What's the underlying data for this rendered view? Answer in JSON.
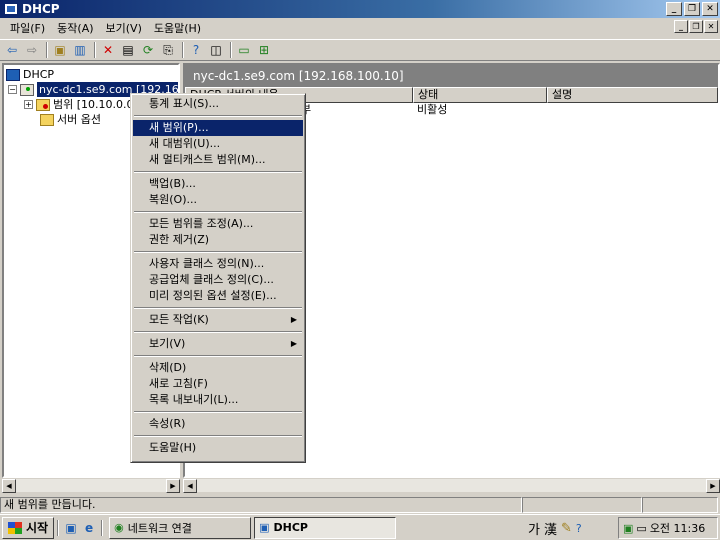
{
  "window": {
    "title": "DHCP"
  },
  "menubar": {
    "items": [
      "파일(F)",
      "동작(A)",
      "보기(V)",
      "도움말(H)"
    ]
  },
  "tree": {
    "root": "DHCP",
    "server": "nyc-dc1.se9.com [192.168.",
    "scope": "범위 [10.10.0.0]",
    "server_options": "서버 옵션"
  },
  "detail": {
    "header": "nyc-dc1.se9.com [192.168.100.10]",
    "columns": [
      "DHCP 서버의 내용",
      "상태",
      "설명"
    ],
    "rows": [
      {
        "name": "",
        "name_tail": "부",
        "status": "비활성",
        "desc": ""
      }
    ]
  },
  "context_menu": {
    "groups": [
      [
        {
          "label": "통계 표시(S)..."
        }
      ],
      [
        {
          "label": "새 범위(P)...",
          "highlighted": true
        },
        {
          "label": "새 대범위(U)..."
        },
        {
          "label": "새 멀티캐스트 범위(M)..."
        }
      ],
      [
        {
          "label": "백업(B)..."
        },
        {
          "label": "복원(O)..."
        }
      ],
      [
        {
          "label": "모든 범위를 조정(A)..."
        },
        {
          "label": "권한 제거(Z)"
        }
      ],
      [
        {
          "label": "사용자 클래스 정의(N)..."
        },
        {
          "label": "공급업체 클래스 정의(C)..."
        },
        {
          "label": "미리 정의된 옵션 설정(E)..."
        }
      ],
      [
        {
          "label": "모든 작업(K)",
          "submenu": true
        }
      ],
      [
        {
          "label": "보기(V)",
          "submenu": true
        }
      ],
      [
        {
          "label": "삭제(D)"
        },
        {
          "label": "새로 고침(F)"
        },
        {
          "label": "목록 내보내기(L)..."
        }
      ],
      [
        {
          "label": "속성(R)"
        }
      ],
      [
        {
          "label": "도움말(H)"
        }
      ]
    ]
  },
  "statusbar": {
    "text": "새 범위를 만듭니다."
  },
  "taskbar": {
    "start": "시작",
    "tasks": [
      {
        "label": "네트워크 연결",
        "active": false
      },
      {
        "label": "DHCP",
        "active": true
      }
    ],
    "ime": [
      "가",
      "漢"
    ],
    "clock": "오전 11:36"
  },
  "colors": {
    "titlebar": "#0a246a",
    "selection": "#0a246a",
    "face": "#d4d0c8"
  }
}
